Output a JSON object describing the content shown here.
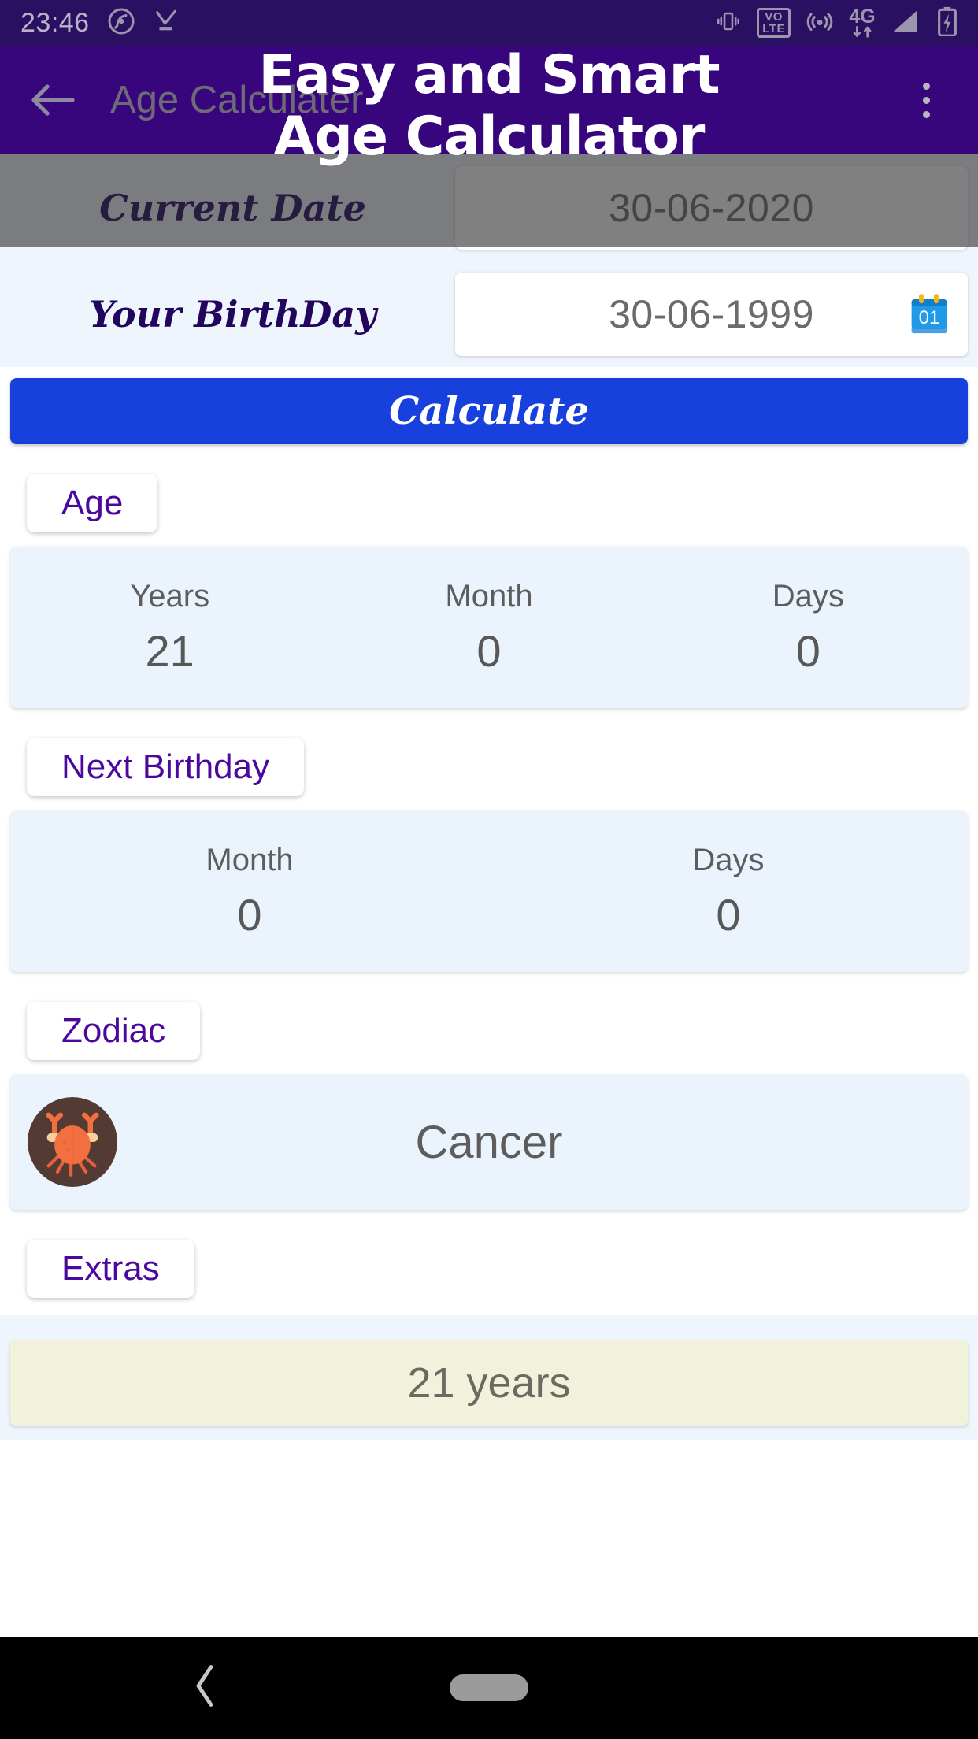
{
  "status_bar": {
    "time": "23:46",
    "icons_left": [
      "data-saver-icon",
      "download-complete-icon"
    ],
    "icons_right": [
      "vibrate-icon",
      "volte-icon",
      "hotspot-icon",
      "network-4g-icon",
      "signal-icon",
      "battery-charging-icon"
    ],
    "volte_top": "VO",
    "volte_bottom": "LTE",
    "network_label": "4G",
    "background_color": "#2a1060"
  },
  "app_bar": {
    "title": "Age Calculater",
    "back_icon": "back-arrow-icon",
    "menu_icon": "overflow-menu-icon",
    "background_color": "#37067d"
  },
  "overlay_title": {
    "line1": "Easy and Smart",
    "line2": "Age Calculator"
  },
  "form": {
    "current_date": {
      "label": "Current Date",
      "value": "30-06-2020",
      "dimmed": true
    },
    "birthday": {
      "label": "Your BirthDay",
      "value": "30-06-1999",
      "icon": "calendar-icon",
      "icon_day": "01"
    },
    "calculate_button": "Calculate"
  },
  "sections": {
    "age": {
      "header": "Age",
      "columns": [
        {
          "label": "Years",
          "value": "21"
        },
        {
          "label": "Month",
          "value": "0"
        },
        {
          "label": "Days",
          "value": "0"
        }
      ]
    },
    "next_birthday": {
      "header": "Next Birthday",
      "columns": [
        {
          "label": "Month",
          "value": "0"
        },
        {
          "label": "Days",
          "value": "0"
        }
      ]
    },
    "zodiac": {
      "header": "Zodiac",
      "sign": "Cancer",
      "icon": "cancer-crab-icon"
    },
    "extras": {
      "header": "Extras",
      "value": "21 years"
    }
  },
  "nav_bar": {
    "back_icon": "nav-back-icon",
    "home_icon": "nav-home-pill-icon",
    "background_color": "#000000"
  },
  "colors": {
    "primary_purple": "#37067d",
    "accent_blue": "#1740dd",
    "card_blue": "#ebf4fd",
    "chip_text": "#4b089e",
    "extras_cream": "#f2f1dc"
  }
}
